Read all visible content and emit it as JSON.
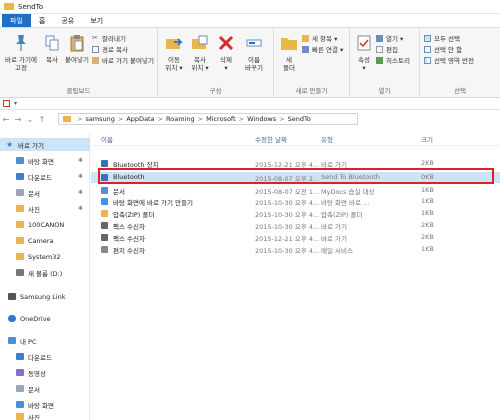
{
  "window": {
    "title": "SendTo"
  },
  "tabs": [
    "파일",
    "홈",
    "공유",
    "보기"
  ],
  "ribbon": {
    "clipboard": {
      "pin": "바로 가기에\n고정",
      "copy": "복사",
      "paste": "붙여넣기",
      "cut": "잘라내기",
      "copy_path": "경로 복사",
      "paste_shortcut": "바로 가기 붙여넣기",
      "label": "클립보드"
    },
    "organize": {
      "move": "이동\n위치 ▾",
      "copy": "복사\n위치 ▾",
      "delete": "삭제\n▾",
      "rename": "이름\n바꾸기",
      "label": "구성"
    },
    "new": {
      "new_folder": "새\n폴더",
      "new_item": "새 항목 ▾",
      "easy_access": "빠른 연결 ▾",
      "label": "새로 만들기"
    },
    "open": {
      "properties": "속성\n▾",
      "open": "열기 ▾",
      "edit": "편집",
      "history": "히스토리",
      "label": "열기"
    },
    "select": {
      "select_all": "모두 선택",
      "select_none": "선택 안 함",
      "invert": "선택 영역 반전",
      "label": "선택"
    }
  },
  "quick_toolbar": {
    "dropdown": "▾"
  },
  "address": {
    "segments": [
      "samsung",
      "AppData",
      "Roaming",
      "Microsoft",
      "Windows",
      "SendTo"
    ],
    "separator": ">"
  },
  "nav": {
    "back": "←",
    "forward": "→",
    "down": "⌄",
    "up": "↑",
    "items": [
      {
        "label": "바로 가기",
        "selected": true
      },
      {
        "label": "바탕 화면",
        "pinned": true
      },
      {
        "label": "다운로드",
        "pinned": true
      },
      {
        "label": "문서",
        "pinned": true
      },
      {
        "label": "사진",
        "pinned": true
      },
      {
        "label": "100CANON"
      },
      {
        "label": "Camera"
      },
      {
        "label": "System32"
      },
      {
        "label": "새 볼륨 (D:)"
      },
      {
        "label": "Samsung Link"
      },
      {
        "label": "OneDrive"
      },
      {
        "label": "내 PC"
      },
      {
        "label": "다운로드"
      },
      {
        "label": "동영상"
      },
      {
        "label": "문서"
      },
      {
        "label": "바탕 화면"
      },
      {
        "label": "사진"
      }
    ],
    "pin_glyph": "✱"
  },
  "columns": {
    "name": "이름",
    "date": "수정한 날짜",
    "type": "유형",
    "size": "크기"
  },
  "files": [
    {
      "name": "Bluetooth 장치",
      "date": "2015-12-21 오후 4...",
      "type": "바로 가기",
      "size": "2KB",
      "icon": "bluetooth-icon",
      "color": "#3b6fb6"
    },
    {
      "name": "Bluetooth",
      "date": "2015-08-07 오후 2...",
      "type": "Send To Bluetooth",
      "size": "0KB",
      "icon": "bluetooth-icon",
      "color": "#3b6fb6",
      "selected": true
    },
    {
      "name": "문서",
      "date": "2015-08-07 오전 1...",
      "type": "MyDocs 습실 대상",
      "size": "1KB",
      "icon": "document-icon",
      "color": "#5b8bd0"
    },
    {
      "name": "바탕 화면에 바로 가기 만들기",
      "date": "2015-10-30 오후 4...",
      "type": "바탕 화면 바로 ...",
      "size": "1KB",
      "icon": "desktop-shortcut-icon",
      "color": "#4a90d9"
    },
    {
      "name": "압축(ZIP) 폴더",
      "date": "2015-10-30 오후 4...",
      "type": "압축(ZIP) 폴더",
      "size": "1KB",
      "icon": "zip-folder-icon",
      "color": "#e8b64a"
    },
    {
      "name": "팩스 수신자",
      "date": "2015-10-30 오후 4...",
      "type": "바로 가기",
      "size": "2KB",
      "icon": "fax-icon",
      "color": "#666666"
    },
    {
      "name": "팩스 수신자",
      "date": "2015-12-21 오후 4...",
      "type": "바로 가기",
      "size": "2KB",
      "icon": "fax-icon",
      "color": "#666666"
    },
    {
      "name": "편지 수신자",
      "date": "2015-10-30 오후 4...",
      "type": "메일 서비스",
      "size": "1KB",
      "icon": "mail-icon",
      "color": "#888888"
    }
  ],
  "colors": {
    "accent": "#1f6fc4",
    "selection": "#cce4f7",
    "highlight_border": "#e01f26",
    "folder": "#e8b64a"
  }
}
